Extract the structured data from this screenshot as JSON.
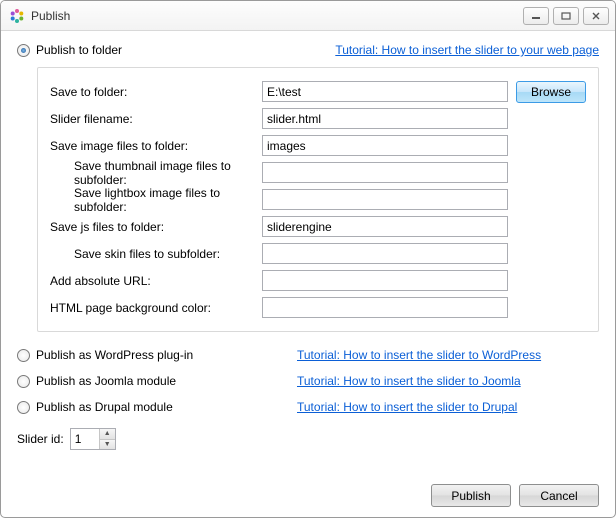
{
  "window": {
    "title": "Publish"
  },
  "options": {
    "folder": {
      "label": "Publish to folder",
      "tutorial": "Tutorial: How to insert the slider to your web page",
      "checked": true
    },
    "wordpress": {
      "label": "Publish as WordPress plug-in",
      "tutorial": "Tutorial: How to insert the slider to WordPress",
      "checked": false
    },
    "joomla": {
      "label": "Publish as Joomla module",
      "tutorial": "Tutorial: How to insert the slider to Joomla",
      "checked": false
    },
    "drupal": {
      "label": "Publish as Drupal module",
      "tutorial": "Tutorial: How to insert the slider to Drupal",
      "checked": false
    }
  },
  "folder_form": {
    "save_to_folder": {
      "label": "Save to folder:",
      "value": "E:\\test"
    },
    "browse": "Browse",
    "slider_filename": {
      "label": "Slider filename:",
      "value": "slider.html"
    },
    "image_folder": {
      "label": "Save image files to folder:",
      "value": "images"
    },
    "thumb_subfolder": {
      "label": "Save thumbnail image files to subfolder:",
      "value": ""
    },
    "lightbox_subfolder": {
      "label": "Save lightbox image files to subfolder:",
      "value": ""
    },
    "js_folder": {
      "label": "Save js files to folder:",
      "value": "sliderengine"
    },
    "skin_subfolder": {
      "label": "Save skin files to subfolder:",
      "value": ""
    },
    "absolute_url": {
      "label": "Add absolute URL:",
      "value": ""
    },
    "bg_color": {
      "label": "HTML page background color:",
      "value": ""
    }
  },
  "slider_id": {
    "label": "Slider id:",
    "value": "1"
  },
  "buttons": {
    "publish": "Publish",
    "cancel": "Cancel"
  }
}
